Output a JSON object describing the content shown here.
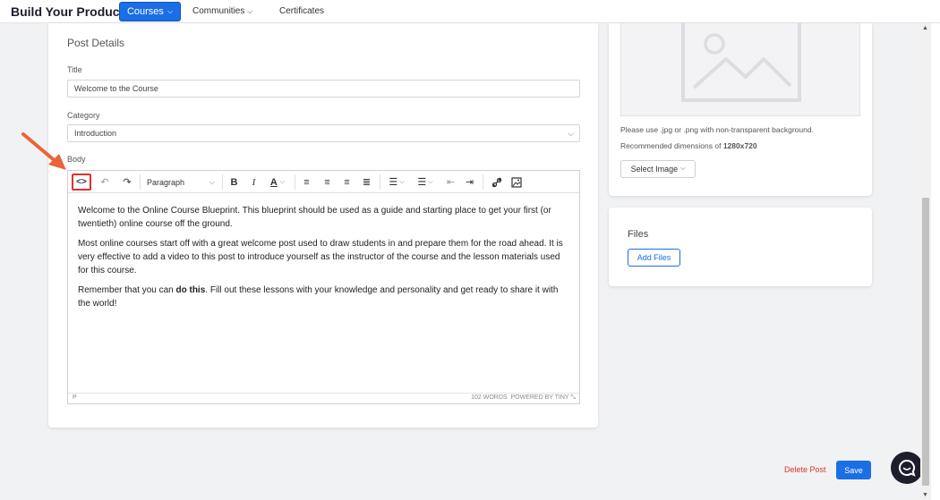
{
  "nav": {
    "brand": "Build Your Product",
    "courses": "Courses",
    "communities": "Communities",
    "certificates": "Certificates"
  },
  "post": {
    "section_title": "Post Details",
    "title_label": "Title",
    "title_value": "Welcome to the Course",
    "category_label": "Category",
    "category_value": "Introduction",
    "body_label": "Body"
  },
  "toolbar": {
    "block_format": "Paragraph",
    "icons": [
      "code-icon",
      "undo-icon",
      "redo-icon",
      "bold-icon",
      "italic-icon",
      "text-color-icon",
      "align-left-icon",
      "align-center-icon",
      "align-right-icon",
      "justify-icon",
      "bullet-list-icon",
      "numbered-list-icon",
      "outdent-icon",
      "indent-icon",
      "link-icon",
      "image-icon"
    ]
  },
  "editor": {
    "p1": "Welcome to the Online Course Blueprint. This blueprint should be used as a guide and starting place to get your first (or twentieth) online course off the ground.",
    "p2": "Most online courses start off with a great welcome post used to draw students in and prepare them for the road ahead. It is very effective to add a video to this post to introduce yourself as the instructor of the course and the lesson materials used for this course.",
    "p3_before": "Remember that you can ",
    "p3_bold": "do this",
    "p3_after": ". Fill out these lessons with your knowledge and personality and get ready to share it with the world!",
    "status_tag": "P",
    "status_words": "102 WORDS",
    "status_powered": "POWERED BY TINY"
  },
  "image_panel": {
    "hint_line1": "Please use .jpg or .png with non-transparent background.",
    "hint_line2_prefix": "Recommended dimensions of ",
    "hint_line2_bold": "1280x720",
    "select_image": "Select Image"
  },
  "files_panel": {
    "title": "Files",
    "add_files": "Add Files"
  },
  "actions": {
    "delete_post": "Delete Post",
    "save": "Save"
  },
  "colors": {
    "accent": "#1a6ee6",
    "danger": "#e0312a",
    "annotation_arrow": "#e8643c"
  }
}
